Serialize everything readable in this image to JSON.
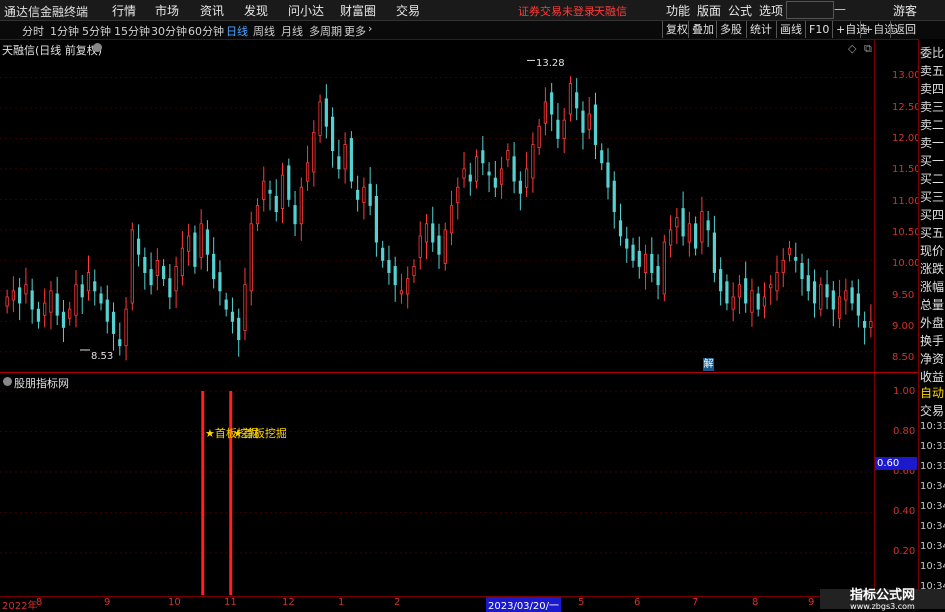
{
  "app": {
    "title": "通达信金融终端",
    "menus": [
      "行情",
      "市场",
      "资讯",
      "发现",
      "问小达",
      "财富圈",
      "交易"
    ],
    "alert_text": "证券交易未登录",
    "alert_brand": "天融信",
    "right_menus": [
      "功能",
      "版面",
      "公式",
      "选项"
    ],
    "guest": "游客"
  },
  "periods": [
    "分时",
    "1分钟",
    "5分钟",
    "15分钟",
    "30分钟",
    "60分钟",
    "日线",
    "周线",
    "月线",
    "多周期",
    "更多"
  ],
  "active_period": "日线",
  "toolbar": [
    "复权",
    "叠加",
    "多股",
    "统计",
    "画线",
    "F10",
    "+自选",
    "返回"
  ],
  "main": {
    "title": "天融信(日线 前复权)",
    "high_label": "13.28",
    "low_label": "8.53",
    "marker": "解",
    "yaxis": [
      "13.00",
      "12.50",
      "12.00",
      "11.50",
      "11.00",
      "10.50",
      "10.00",
      "9.50",
      "9.00",
      "8.50"
    ]
  },
  "sub": {
    "title": "股朋指标网",
    "signal1": "★首板挖掘",
    "signal2": "★首板挖掘",
    "yaxis": [
      "1.00",
      "0.80",
      "0.60",
      "0.40",
      "0.20"
    ],
    "current_value": "0.60"
  },
  "right_panel": {
    "labels": [
      "委比",
      "卖五",
      "卖四",
      "卖三",
      "卖二",
      "卖一",
      "买一",
      "买二",
      "买三",
      "买四",
      "买五",
      "现价",
      "涨跌",
      "涨幅",
      "总量",
      "外盘",
      "换手",
      "净资",
      "收益"
    ],
    "auto": "自动",
    "trade": "交易",
    "times": [
      "10:33",
      "10:33",
      "10:33",
      "10:34",
      "10:34",
      "10:34",
      "10:34",
      "10:34",
      "10:34"
    ]
  },
  "dates": [
    "2022年",
    "8",
    "9",
    "10",
    "11",
    "12",
    "1",
    "2",
    "2023/03/20/一",
    "5",
    "6",
    "7",
    "8",
    "9"
  ],
  "watermark": {
    "line1": "指标公式网",
    "line2": "www.zbgs3.com"
  },
  "chart_data": {
    "type": "candlestick",
    "price_range": [
      8.5,
      13.28
    ],
    "high": 13.28,
    "low": 8.53,
    "closes": [
      9.4,
      9.5,
      9.3,
      9.6,
      9.2,
      9.0,
      9.3,
      9.5,
      9.1,
      8.9,
      9.2,
      9.6,
      9.4,
      9.8,
      9.5,
      9.3,
      9.0,
      8.8,
      8.6,
      9.2,
      10.5,
      10.1,
      9.8,
      9.6,
      10.0,
      9.7,
      9.4,
      9.9,
      10.2,
      10.4,
      9.9,
      10.6,
      10.1,
      9.7,
      9.5,
      9.2,
      9.0,
      8.7,
      9.6,
      10.6,
      10.9,
      11.3,
      11.1,
      10.8,
      11.4,
      11.0,
      10.6,
      11.2,
      11.6,
      12.1,
      12.6,
      12.2,
      11.8,
      11.5,
      11.9,
      11.3,
      11.0,
      11.2,
      10.9,
      10.3,
      10.0,
      9.8,
      9.6,
      9.5,
      9.7,
      9.9,
      10.4,
      10.6,
      10.3,
      10.1,
      10.5,
      10.9,
      11.2,
      11.5,
      11.3,
      11.7,
      11.6,
      11.4,
      11.2,
      11.5,
      11.8,
      11.3,
      11.1,
      11.5,
      11.9,
      12.2,
      12.6,
      12.4,
      12.0,
      12.3,
      12.9,
      12.5,
      12.1,
      12.4,
      11.9,
      11.6,
      11.2,
      10.8,
      10.4,
      10.2,
      10.0,
      9.9,
      10.1,
      9.8,
      9.6,
      10.3,
      10.5,
      10.7,
      10.4,
      10.6,
      10.2,
      10.8,
      10.5,
      9.8,
      9.5,
      9.3,
      9.4,
      9.6,
      9.3,
      9.5,
      9.2,
      9.4,
      9.6,
      9.8,
      10.0,
      10.2,
      10.0,
      9.7,
      9.5,
      9.3,
      9.6,
      9.4,
      9.2,
      9.4,
      9.5,
      9.3,
      9.1,
      8.9,
      9.0
    ],
    "sub_series": {
      "name": "股朋指标网",
      "signal_positions": [
        0.232,
        0.264
      ],
      "ylim": [
        0.2,
        1.0
      ],
      "current": 0.6
    }
  }
}
